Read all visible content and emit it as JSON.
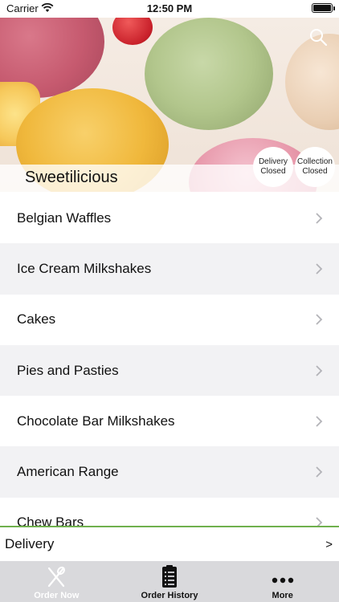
{
  "status_bar": {
    "carrier": "Carrier",
    "time": "12:50 PM"
  },
  "hero": {
    "restaurant_name": "Sweetilicious",
    "delivery_status": [
      "Delivery",
      "Closed"
    ],
    "collection_status": [
      "Collection",
      "Closed"
    ]
  },
  "menu": {
    "items": [
      {
        "label": "Belgian Waffles"
      },
      {
        "label": "Ice Cream Milkshakes"
      },
      {
        "label": "Cakes"
      },
      {
        "label": "Pies and Pasties"
      },
      {
        "label": "Chocolate Bar Milkshakes"
      },
      {
        "label": "American Range"
      },
      {
        "label": "Chew Bars"
      }
    ]
  },
  "delivery_bar": {
    "label": "Delivery",
    "arrow": ">"
  },
  "tabs": [
    {
      "label": "Order Now",
      "icon": "fork-knife-icon",
      "active": false
    },
    {
      "label": "Order History",
      "icon": "receipt-icon",
      "active": true
    },
    {
      "label": "More",
      "icon": "more-dots-icon",
      "active": true
    }
  ],
  "colors": {
    "accent_line": "#6fb04d",
    "tab_bar": "#d9d9dc",
    "list_alt_row": "#f2f2f4"
  }
}
